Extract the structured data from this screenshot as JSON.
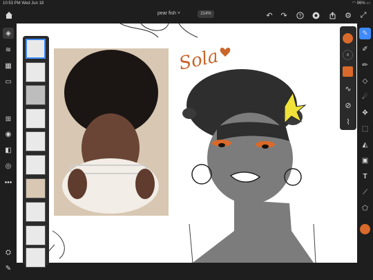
{
  "status": {
    "time": "10:53 PM",
    "date": "Wed Jun 18",
    "battery": "96%"
  },
  "document": {
    "title": "pear fish",
    "title_chevron": "˅",
    "zoom": "214%"
  },
  "canvas_text": {
    "signature": "Sola"
  },
  "colors": {
    "accent": "#3d8bff",
    "brush": "#d96a2b",
    "chrome": "#1e1e1e"
  },
  "brush": {
    "size_label": "8"
  },
  "icons": {
    "home": "home-icon",
    "undo": "undo-icon",
    "redo": "redo-icon",
    "help": "help-icon",
    "cloud": "cloud-icon",
    "share": "share-icon",
    "settings": "gear-icon",
    "fullscreen": "fullscreen-icon"
  }
}
